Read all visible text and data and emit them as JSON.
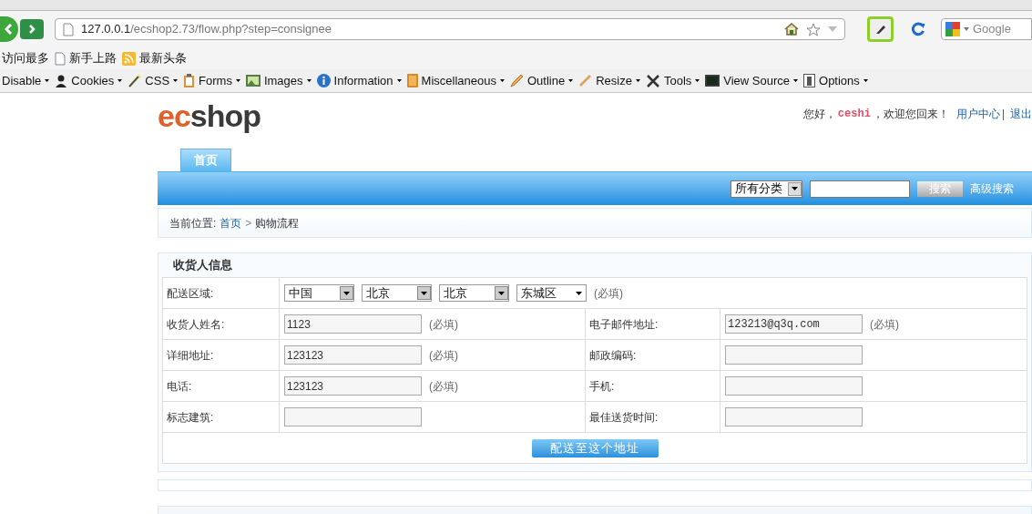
{
  "browser": {
    "url_host": "127.0.0.1",
    "url_path": "/ecshop2.73/flow.php?step=consignee",
    "search_placeholder": "Google",
    "bookmarks": [
      {
        "label": "访问最多",
        "kind": "text"
      },
      {
        "label": "新手上路",
        "kind": "page"
      },
      {
        "label": "最新头条",
        "kind": "feed"
      }
    ],
    "dev_toolbar": [
      {
        "label": "Disable",
        "kind": "none"
      },
      {
        "label": "Cookies",
        "kind": "person"
      },
      {
        "label": "CSS",
        "kind": "wand"
      },
      {
        "label": "Forms",
        "kind": "clipboard"
      },
      {
        "label": "Images",
        "kind": "image"
      },
      {
        "label": "Information",
        "kind": "info"
      },
      {
        "label": "Miscellaneous",
        "kind": "book"
      },
      {
        "label": "Outline",
        "kind": "pencil"
      },
      {
        "label": "Resize",
        "kind": "ruler"
      },
      {
        "label": "Tools",
        "kind": "tools"
      },
      {
        "label": "View Source",
        "kind": "terminal"
      },
      {
        "label": "Options",
        "kind": "switch"
      }
    ]
  },
  "header": {
    "logo": "ecshop",
    "greeting": "您好，",
    "username": "ceshi",
    "welcome": "，欢迎您回来！",
    "links": [
      "用户中心",
      "退出"
    ],
    "separator": "|"
  },
  "nav_tabs": [
    {
      "label": "首页",
      "selected": true
    }
  ],
  "search": {
    "category": "所有分类",
    "button": "搜索",
    "advanced": "高级搜索"
  },
  "breadcrumb": {
    "prefix": "当前位置:",
    "items": [
      "首页",
      "购物流程"
    ],
    "separator": ">"
  },
  "consignee": {
    "title": "收货人信息",
    "region_label": "配送区域:",
    "regions": [
      {
        "value": "中国",
        "kind": "boxed"
      },
      {
        "value": "北京",
        "kind": "boxed"
      },
      {
        "value": "北京",
        "kind": "boxed"
      },
      {
        "value": "东城区",
        "kind": "plain"
      }
    ],
    "region_note": "(必填)",
    "rows": [
      [
        {
          "label": "收货人姓名:",
          "value": "1123",
          "note": "(必填)",
          "mono": false
        },
        {
          "label": "电子邮件地址:",
          "value": "123213@q3q.com",
          "note": "(必填)",
          "mono": true
        }
      ],
      [
        {
          "label": "详细地址:",
          "value": "123123",
          "note": "(必填)",
          "mono": false
        },
        {
          "label": "邮政编码:"
        }
      ],
      [
        {
          "label": "电话:",
          "value": "123123",
          "note": "(必填)",
          "mono": false
        },
        {
          "label": "手机:"
        }
      ],
      [
        {
          "label": "标志建筑:"
        },
        {
          "label": "最佳送货时间:"
        }
      ]
    ],
    "submit": "配送至这个地址"
  }
}
